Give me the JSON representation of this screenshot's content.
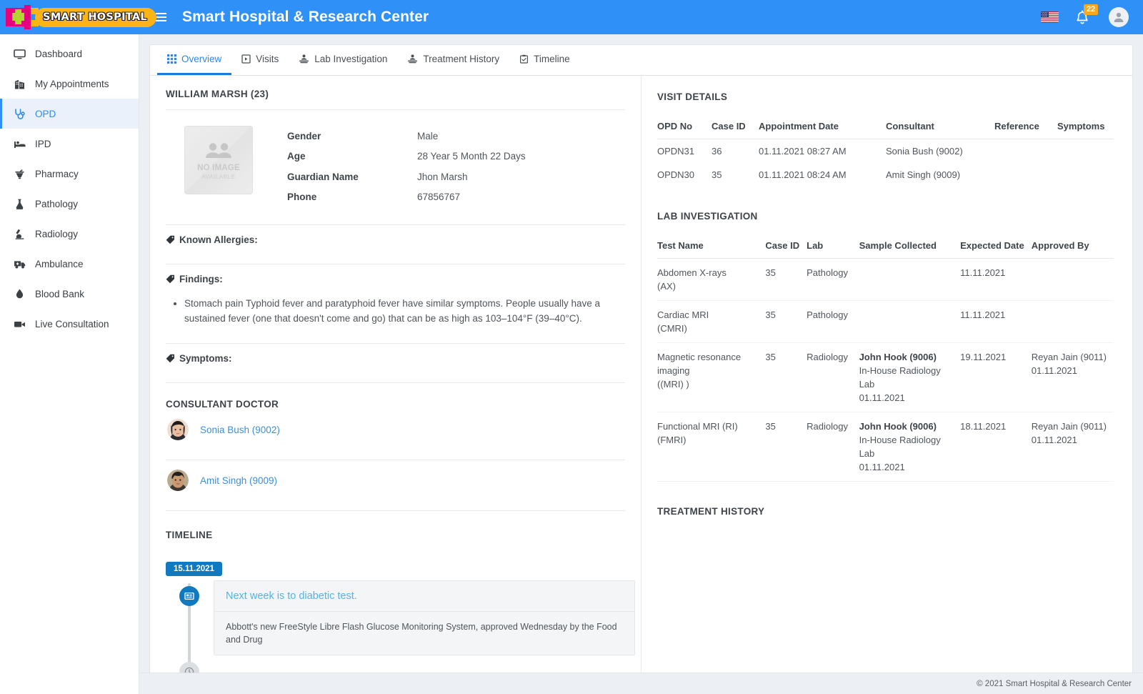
{
  "header": {
    "logo_text": "SMART HOSPITAL",
    "menu_icon": "hamburger-icon",
    "title": "Smart Hospital & Research Center",
    "language_icon": "us-flag-icon",
    "notification_icon": "bell-icon",
    "notification_count": "22",
    "account_icon": "user-avatar-icon",
    "accent_color": "#2f91f7",
    "badge_color": "#f7a81b"
  },
  "sidebar": {
    "items": [
      {
        "label": "Dashboard",
        "icon": "monitor-icon",
        "active": false
      },
      {
        "label": "My Appointments",
        "icon": "hospital-building-icon",
        "active": false
      },
      {
        "label": "OPD",
        "icon": "stethoscope-icon",
        "active": true
      },
      {
        "label": "IPD",
        "icon": "hospital-bed-icon",
        "active": false
      },
      {
        "label": "Pharmacy",
        "icon": "mortar-pestle-icon",
        "active": false
      },
      {
        "label": "Pathology",
        "icon": "flask-icon",
        "active": false
      },
      {
        "label": "Radiology",
        "icon": "microscope-icon",
        "active": false
      },
      {
        "label": "Ambulance",
        "icon": "ambulance-icon",
        "active": false
      },
      {
        "label": "Blood Bank",
        "icon": "blood-drop-icon",
        "active": false
      },
      {
        "label": "Live Consultation",
        "icon": "video-camera-icon",
        "active": false
      }
    ]
  },
  "tabs": [
    {
      "label": "Overview",
      "icon": "grid-icon",
      "active": true
    },
    {
      "label": "Visits",
      "icon": "play-square-icon",
      "active": false
    },
    {
      "label": "Lab Investigation",
      "icon": "lab-icon",
      "active": false
    },
    {
      "label": "Treatment History",
      "icon": "lab-icon",
      "active": false
    },
    {
      "label": "Timeline",
      "icon": "clipboard-check-icon",
      "active": false
    }
  ],
  "patient": {
    "name_heading": "WILLIAM MARSH (23)",
    "photo_line1": "NO IMAGE",
    "photo_line2": "AVAILABLE",
    "fields": [
      {
        "key": "Gender",
        "value": "Male"
      },
      {
        "key": "Age",
        "value": "28 Year 5 Month 22 Days"
      },
      {
        "key": "Guardian Name",
        "value": "Jhon Marsh"
      },
      {
        "key": "Phone",
        "value": "67856767"
      }
    ],
    "known_allergies_label": "Known Allergies:",
    "known_allergies_value": "",
    "findings_label": "Findings:",
    "findings": [
      "Stomach pain Typhoid fever and paratyphoid fever have similar symptoms. People usually have a sustained fever (one that doesn't come and go) that can be as high as 103–104°F (39–40°C)."
    ],
    "symptoms_label": "Symptoms:",
    "symptoms_value": ""
  },
  "consultant_doctor": {
    "title": "CONSULTANT DOCTOR",
    "doctors": [
      {
        "name": "Sonia Bush (9002)",
        "avatar": "doctor-avatar-sonia"
      },
      {
        "name": "Amit Singh (9009)",
        "avatar": "doctor-avatar-amit"
      }
    ]
  },
  "timeline": {
    "title": "TIMELINE",
    "date_badge": "15.11.2021",
    "node_icon": "news-card-icon",
    "end_icon": "clock-icon",
    "entry_title": "Next week is to diabetic test.",
    "entry_body": "Abbott's new FreeStyle Libre Flash Glucose Monitoring System, approved Wednesday by the Food and Drug"
  },
  "visit_details": {
    "title": "VISIT DETAILS",
    "columns": [
      "OPD No",
      "Case ID",
      "Appointment Date",
      "Consultant",
      "Reference",
      "Symptoms"
    ],
    "rows": [
      {
        "opd_no": "OPDN31",
        "case_id": "36",
        "appointment_date": "01.11.2021 08:27 AM",
        "consultant": "Sonia Bush (9002)",
        "reference": "",
        "symptoms": ""
      },
      {
        "opd_no": "OPDN30",
        "case_id": "35",
        "appointment_date": "01.11.2021 08:24 AM",
        "consultant": "Amit Singh (9009)",
        "reference": "",
        "symptoms": ""
      }
    ]
  },
  "lab_investigation": {
    "title": "LAB INVESTIGATION",
    "columns": [
      "Test Name",
      "Case ID",
      "Lab",
      "Sample Collected",
      "Expected Date",
      "Approved By"
    ],
    "rows": [
      {
        "test_name": "Abdomen X-rays",
        "test_code": "(AX)",
        "case_id": "35",
        "lab": "Pathology",
        "collected_by": "",
        "collected_lab": "",
        "collected_date": "",
        "expected_date": "11.11.2021",
        "approved_by": "",
        "approved_date": ""
      },
      {
        "test_name": "Cardiac MRI",
        "test_code": "(CMRI)",
        "case_id": "35",
        "lab": "Pathology",
        "collected_by": "",
        "collected_lab": "",
        "collected_date": "",
        "expected_date": "11.11.2021",
        "approved_by": "",
        "approved_date": ""
      },
      {
        "test_name": "Magnetic resonance imaging",
        "test_code": "((MRI) )",
        "case_id": "35",
        "lab": "Radiology",
        "collected_by": "John Hook (9006)",
        "collected_lab": "In-House Radiology Lab",
        "collected_date": "01.11.2021",
        "expected_date": "19.11.2021",
        "approved_by": "Reyan Jain (9011)",
        "approved_date": "01.11.2021"
      },
      {
        "test_name": "Functional MRI (RI)",
        "test_code": "(FMRI)",
        "case_id": "35",
        "lab": "Radiology",
        "collected_by": "John Hook (9006)",
        "collected_lab": "In-House Radiology Lab",
        "collected_date": "01.11.2021",
        "expected_date": "18.11.2021",
        "approved_by": "Reyan Jain (9011)",
        "approved_date": "01.11.2021"
      }
    ]
  },
  "treatment_history": {
    "title": "TREATMENT HISTORY",
    "rows": []
  },
  "footer": {
    "copyright": "© 2021 Smart Hospital & Research Center"
  }
}
